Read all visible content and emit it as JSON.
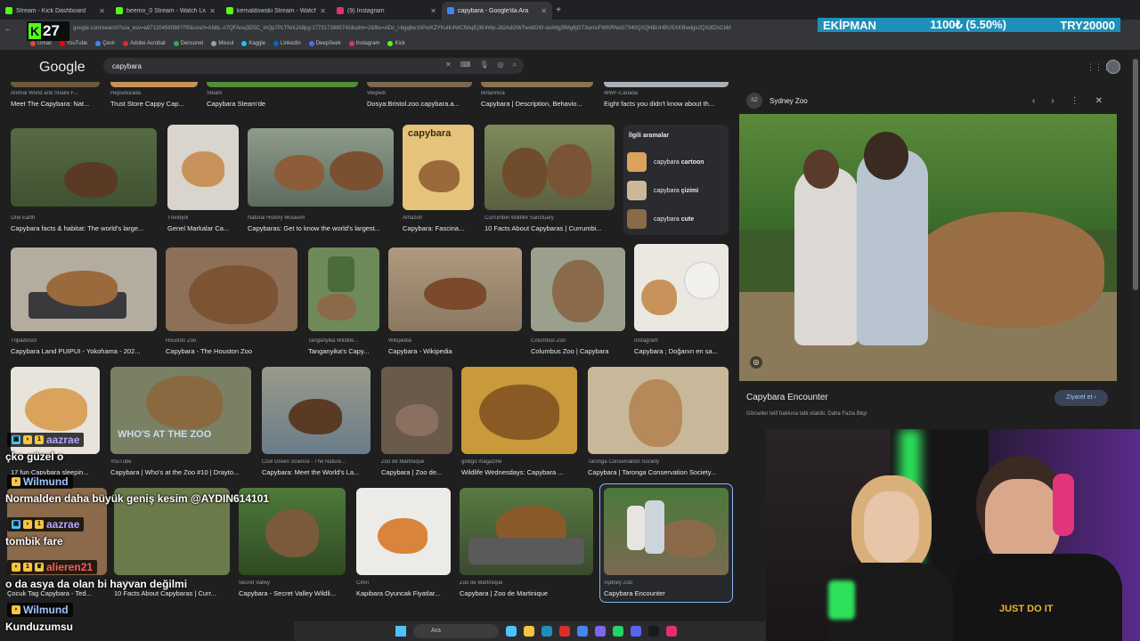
{
  "browser": {
    "tabs": [
      {
        "label": "Stream - Kick Dashboard",
        "color": "#53fc18",
        "active": false
      },
      {
        "label": "beemo_0 Stream - Watch Live on Kick",
        "color": "#53fc18",
        "active": false
      },
      {
        "label": "kemaldowski Stream - Watch Live",
        "color": "#53fc18",
        "active": false
      },
      {
        "label": "(9) Instagram",
        "color": "#e1306c",
        "active": false
      },
      {
        "label": "capybara - Google'da Ara",
        "color": "#4285f4",
        "active": true
      }
    ],
    "new_tab": "+",
    "url": "google.com/search?sca_esv=a97120459098?7f0&sxsrf=ANbL-n7QFAovj3D5C_mQp7PLTNnIJA8pg:1773173895742&udm=2&fbs=ADc_l-bgqbw1hPsrKZYKulK4WCftAqEj3K4Wp-J82AdOWTwebDW-skANg3fMg6jGT3wmcFWKRNxG7340QXQHBUHBUSXKBwdgx2QXdfZACbM",
    "bookmarks": [
      {
        "label": "Gmail",
        "color": "#ea4335"
      },
      {
        "label": "YouTube",
        "color": "#ff0000"
      },
      {
        "label": "Çevir",
        "color": "#4285f4"
      },
      {
        "label": "Adobe Acrobat",
        "color": "#d93025"
      },
      {
        "label": "Densonet",
        "color": "#34a853"
      },
      {
        "label": "Mixxul",
        "color": "#9aa0a6"
      },
      {
        "label": "Kaggle",
        "color": "#20beff"
      },
      {
        "label": "LinkedIn",
        "color": "#0a66c2"
      },
      {
        "label": "DeepSeek",
        "color": "#4d6bfe"
      },
      {
        "label": "Instagram",
        "color": "#e1306c"
      },
      {
        "label": "Kick",
        "color": "#53fc18"
      }
    ]
  },
  "overlay": {
    "kick_count": "27",
    "ticker_name": "EKİPMAN",
    "ticker_value": "1100₺ (5.50%)",
    "ticker_goal": "TRY20000"
  },
  "google": {
    "logo": "Google",
    "query": "capybara",
    "related": {
      "header": "İlgili aramalar",
      "items": [
        {
          "prefix": "capybara ",
          "bold": "cartoon"
        },
        {
          "prefix": "capybara ",
          "bold": "çizimi"
        },
        {
          "prefix": "capybara ",
          "bold": "cute"
        }
      ]
    },
    "results": [
      {
        "src": "Animal World and Snake F...",
        "title": "Meet The Capybara: Nat..."
      },
      {
        "src": "Hepsiburada",
        "title": "Trust Store Cappy Cap..."
      },
      {
        "src": "Steam",
        "title": "Capybara Steam'de"
      },
      {
        "src": "Vikipedi",
        "title": "Dosya:Bristol.zoo.capybara.a..."
      },
      {
        "src": "Britannica",
        "title": "Capybara | Description, Behavio..."
      },
      {
        "src": "WWF-Canada",
        "title": "Eight facts you didn't know about th..."
      },
      {
        "src": "One Earth",
        "title": "Capybara facts & habitat: The world's large..."
      },
      {
        "src": "Trendyol",
        "title": "Genel Markalar Ca..."
      },
      {
        "src": "Natural History Museum",
        "title": "Capybaras: Get to know the world's largest..."
      },
      {
        "src": "Amazon",
        "title": "Capybara: Fascina..."
      },
      {
        "src": "Currumbin Wildlife Sanctuary",
        "title": "10 Facts About Capybaras | Currumbi..."
      },
      {
        "src": "Tripadvisor",
        "title": "Capybara Land PUIPUI - Yokohama - 202..."
      },
      {
        "src": "Houston Zoo",
        "title": "Capybara - The Houston Zoo"
      },
      {
        "src": "Tanganyika Wildlife...",
        "title": "Tanganyika's Capy..."
      },
      {
        "src": "Wikipedia",
        "title": "Capybara - Wikipedia"
      },
      {
        "src": "Columbus Zoo",
        "title": "Columbus Zoo | Capybara"
      },
      {
        "src": "Instagram",
        "title": "Capybara ; Doğanın en sa..."
      },
      {
        "src": "",
        "title": "17 fun Capybara sleepin..."
      },
      {
        "src": "YouTube",
        "title": "Capybara | Who's at the Zoo #10 | Drayto..."
      },
      {
        "src": "Cool Green Science - The Nature...",
        "title": "Capybara: Meet the World's La..."
      },
      {
        "src": "Zoo de Martinique",
        "title": "Capybara | Zoo de..."
      },
      {
        "src": "ginkgo magazine",
        "title": "Wildlife Wednesdays: Capybara ..."
      },
      {
        "src": "Taronga Conservation Society",
        "title": "Capybara | Taronga Conservation Society..."
      },
      {
        "src": "",
        "title": "Çocuk Tag Capybara - Ted..."
      },
      {
        "src": "Sanctuary",
        "title": "10 Facts About Capybaras | Curr..."
      },
      {
        "src": "Secret Valley",
        "title": "Capybara - Secret Valley Wildli..."
      },
      {
        "src": "Cimri",
        "title": "Kapibara Oyuncak Fiyatlar..."
      },
      {
        "src": "Zoo de Martinique",
        "title": "Capybara | Zoo de Martinique"
      },
      {
        "src": "Sydney Zoo",
        "title": "Capybara Encounter"
      }
    ],
    "badge_text": "WHO'S AT THE ZOO",
    "panel": {
      "source": "Sydney Zoo",
      "logo_text": "SZ",
      "title": "Capybara Encounter",
      "note": "Görseller telif hakkına tabi olabilir. Daha Fazla Bilgi",
      "visit": "Ziyaret et"
    }
  },
  "chat": [
    {
      "user": "aazrae",
      "color": "#b2a4ff",
      "message": "çko güzel o"
    },
    {
      "user": "Wilmund",
      "color": "#a0c4ff",
      "message": "Normalden daha büyük geniş kesim @AYDIN614101"
    },
    {
      "user": "aazrae",
      "color": "#b2a4ff",
      "message": "tombik fare"
    },
    {
      "user": "alieren21",
      "color": "#ff5a5a",
      "message": "o da asya da olan bi hayvan değilmi"
    },
    {
      "user": "Wilmund",
      "color": "#a0c4ff",
      "message": "Kunduzumsu"
    }
  ],
  "taskbar": {
    "search": "Ara"
  },
  "webcam": {
    "shirt_text": "JUST DO IT"
  },
  "colors": {
    "kick_green": "#53fc18",
    "ticker_blue": "#1e8fb8",
    "link_blue": "#8ab4f8"
  }
}
